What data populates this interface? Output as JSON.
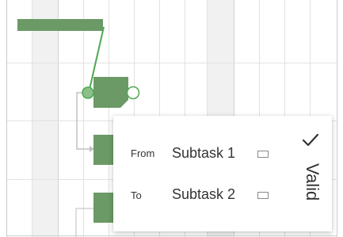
{
  "gantt": {
    "bar_color": "#6b9a66",
    "connector_color": "#4caa4f",
    "link_color": "#c0c0c0"
  },
  "dependency_popup": {
    "from_label": "From",
    "from_value": "Subtask 1",
    "to_label": "To",
    "to_value": "Subtask 2",
    "status_text": "Valid",
    "status_icon": "checkmark-icon"
  }
}
